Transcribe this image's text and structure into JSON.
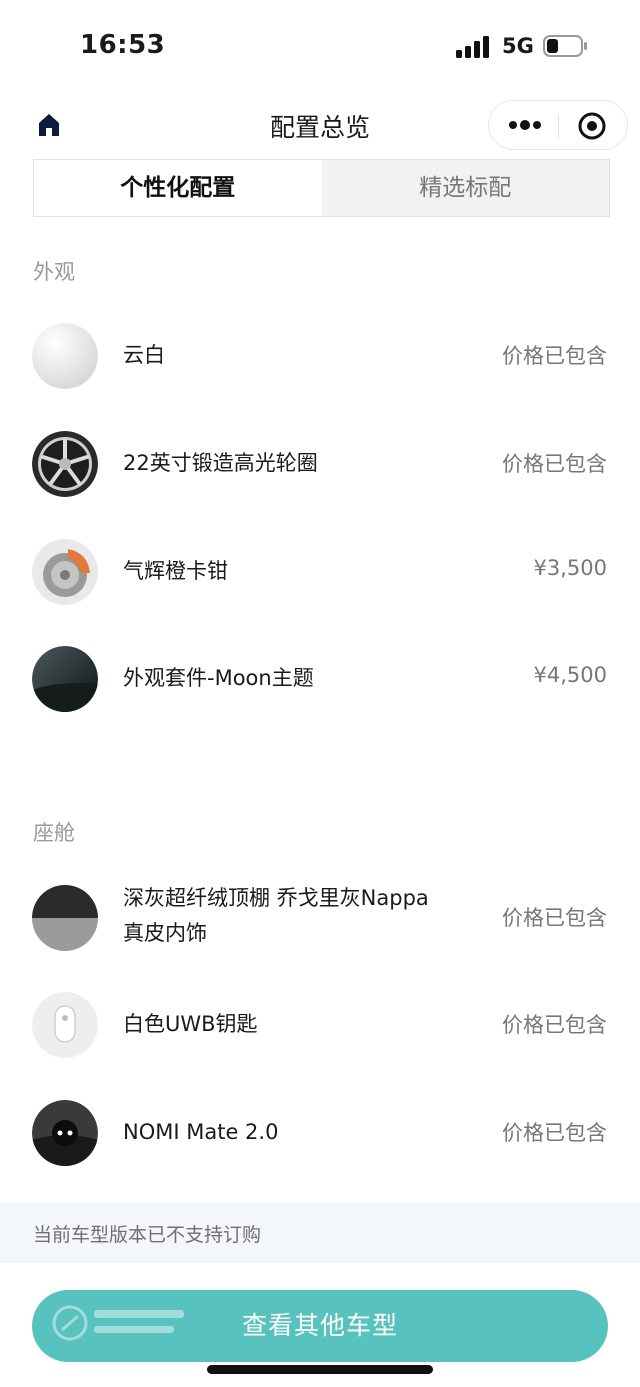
{
  "status_bar": {
    "time": "16:53",
    "network": "5G"
  },
  "nav": {
    "title": "配置总览"
  },
  "tabs": [
    {
      "label": "个性化配置",
      "active": true
    },
    {
      "label": "精选标配",
      "active": false
    }
  ],
  "exterior": {
    "label": "外观",
    "items": [
      {
        "name": "云白",
        "price": "价格已包含",
        "icon": "white-paint-swatch"
      },
      {
        "name": "22英寸锻造高光轮圈",
        "price": "价格已包含",
        "icon": "wheel-rim"
      },
      {
        "name": "气辉橙卡钳",
        "price": "¥3,500",
        "icon": "orange-brake-caliper"
      },
      {
        "name": "外观套件-Moon主题",
        "price": "¥4,500",
        "icon": "moon-theme-kit"
      }
    ]
  },
  "cabin": {
    "label": "座舱",
    "items": [
      {
        "name_line1": "深灰超纤绒顶棚 乔戈里灰Nappa",
        "name_line2": "真皮内饰",
        "price": "价格已包含",
        "icon": "interior-swatch"
      },
      {
        "name": "白色UWB钥匙",
        "price": "价格已包含",
        "icon": "uwb-key"
      },
      {
        "name": "NOMI Mate 2.0",
        "price": "价格已包含",
        "icon": "nomi-mate"
      }
    ]
  },
  "notice": "当前车型版本已不支持订购",
  "cta": "查看其他车型",
  "colors": {
    "accent": "#58c2be",
    "muted_text": "#9a9a9a",
    "notice_bg": "#f3f7fb"
  }
}
